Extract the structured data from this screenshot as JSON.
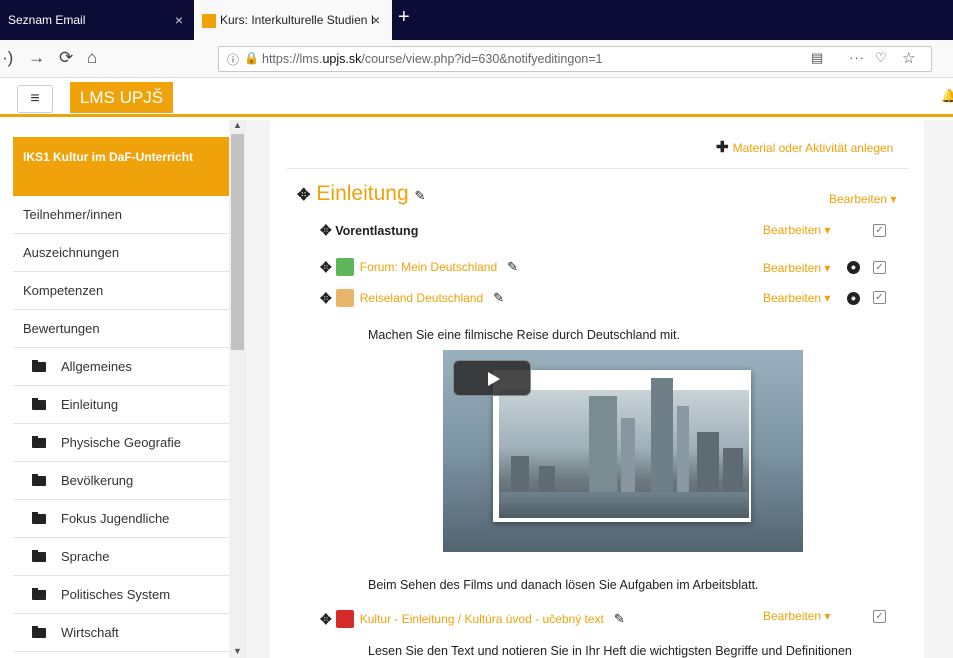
{
  "browser": {
    "tabs": [
      {
        "title": "Seznam Email"
      },
      {
        "title": "Kurs: Interkulturelle Studien I"
      }
    ],
    "close_glyph": "×",
    "new_tab_glyph": "+",
    "url_prefix": "https://lms.",
    "url_domain": "upjs.sk",
    "url_path": "/course/view.php?id=630&notifyeditingon=1",
    "more_glyph": "···"
  },
  "header": {
    "brand": "LMS UPJŠ"
  },
  "sidebar": {
    "course": "IKS1 Kultur im DaF-Unterricht",
    "items": [
      "Teilnehmer/innen",
      "Auszeichnungen",
      "Kompetenzen",
      "Bewertungen"
    ],
    "sections": [
      "Allgemeines",
      "Einleitung",
      "Physische Geografie",
      "Bevölkerung",
      "Fokus Jugendliche",
      "Sprache",
      "Politisches System",
      "Wirtschaft"
    ]
  },
  "main": {
    "add_activity": "Material oder Aktivität anlegen",
    "section_title": "Einleitung",
    "edit_label": "Bearbeiten ▾",
    "label_title": "Vorentlastung",
    "activities": [
      {
        "name": "Forum: Mein Deutschland",
        "icon": "forum-icon"
      },
      {
        "name": "Reiseland Deutschland",
        "icon": "lesson-icon"
      },
      {
        "name": "Kultur - Einleitung / Kultúra úvod - učebný text",
        "icon": "pdf-icon"
      }
    ],
    "text1": "Machen Sie eine filmische Reise durch Deutschland mit.",
    "text2": "Beim Sehen des Films und danach lösen Sie Aufgaben im Arbeitsblatt.",
    "text3": "Lesen Sie den Text und notieren Sie in Ihr Heft die wichtigsten Begriffe und Definitionen"
  },
  "colors": {
    "accent": "#f0a20b",
    "tabbar": "#0c0c37"
  }
}
